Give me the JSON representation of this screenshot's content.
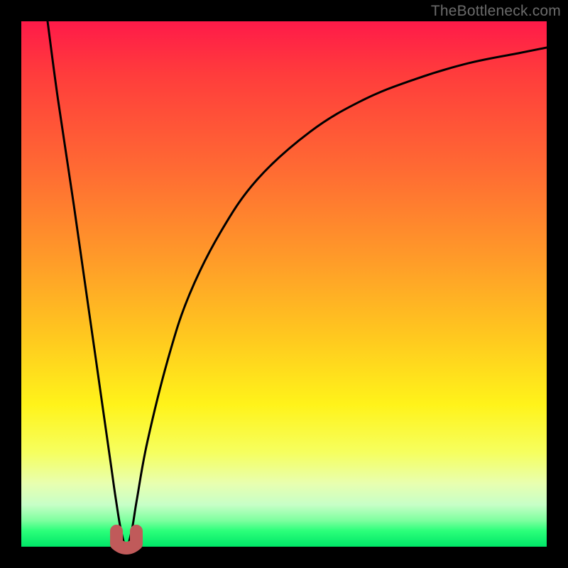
{
  "watermark": "TheBottleneck.com",
  "chart_data": {
    "type": "line",
    "title": "",
    "xlabel": "",
    "ylabel": "",
    "xlim": [
      0,
      100
    ],
    "ylim": [
      0,
      100
    ],
    "grid": false,
    "series": [
      {
        "name": "bottleneck-curve",
        "x": [
          5,
          7,
          10,
          13,
          15,
          17,
          18,
          19,
          20,
          21,
          22,
          24,
          28,
          32,
          38,
          45,
          55,
          65,
          75,
          85,
          95,
          100
        ],
        "values": [
          100,
          85,
          65,
          44,
          30,
          16,
          9,
          3,
          0,
          3,
          9,
          20,
          36,
          48,
          60,
          70,
          79,
          85,
          89,
          92,
          94,
          95
        ]
      }
    ],
    "marker": {
      "name": "minimum-marker",
      "x": 20,
      "value": 0,
      "color": "#c05a5a"
    }
  },
  "colors": {
    "curve": "#000000",
    "marker": "#c05a5a",
    "frame": "#000000"
  }
}
